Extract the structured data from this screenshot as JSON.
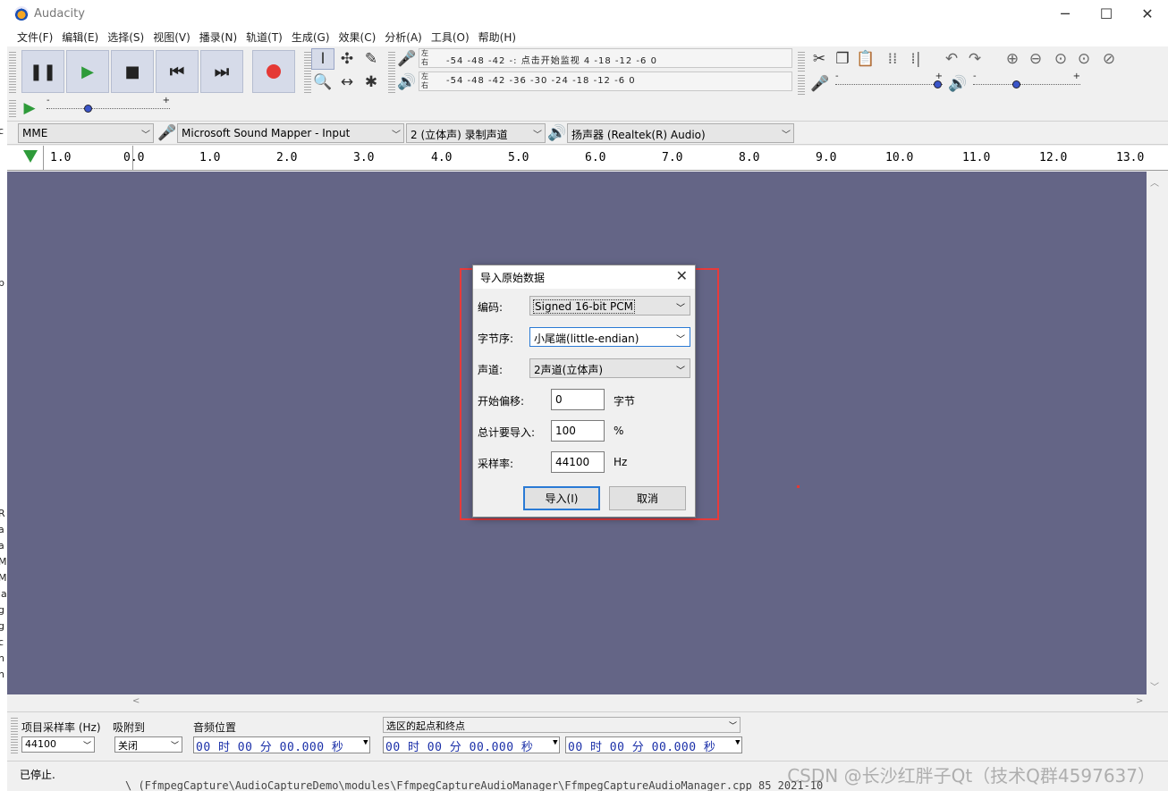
{
  "window": {
    "title": "Audacity",
    "controls": {
      "minimize": "─",
      "maximize": "☐",
      "close": "✕"
    }
  },
  "menu": [
    "文件(F)",
    "编辑(E)",
    "选择(S)",
    "视图(V)",
    "播录(N)",
    "轨道(T)",
    "生成(G)",
    "效果(C)",
    "分析(A)",
    "工具(O)",
    "帮助(H)"
  ],
  "meters": {
    "lr_label": "左\n右",
    "record_scale": "-54   -48   -42   -:  点击开始监视  4   -18   -12   -6   0",
    "play_scale": "-54   -48   -42   -36   -30   -24   -18   -12   -6   0",
    "slider_minus": "-",
    "slider_plus": "+"
  },
  "device": {
    "host": "MME",
    "input_device": "Microsoft Sound Mapper - Input",
    "channels": "2 (立体声) 录制声道",
    "output_device": "扬声器 (Realtek(R) Audio)"
  },
  "ruler": {
    "ticks": [
      "1.0",
      "0.0",
      "1.0",
      "2.0",
      "3.0",
      "4.0",
      "5.0",
      "6.0",
      "7.0",
      "8.0",
      "9.0",
      "10.0",
      "11.0",
      "12.0",
      "13.0"
    ]
  },
  "dialog": {
    "title": "导入原始数据",
    "close": "✕",
    "encoding_label": "编码:",
    "encoding_value": "Signed 16-bit PCM",
    "byteorder_label": "字节序:",
    "byteorder_value": "小尾端(little-endian)",
    "channels_label": "声道:",
    "channels_value": "2声道(立体声)",
    "offset_label": "开始偏移:",
    "offset_value": "0",
    "offset_unit": "字节",
    "amount_label": "总计要导入:",
    "amount_value": "100",
    "amount_unit": "%",
    "rate_label": "采样率:",
    "rate_value": "44100",
    "rate_unit": "Hz",
    "import_button": "导入(I)",
    "cancel_button": "取消"
  },
  "selection": {
    "rate_label": "项目采样率 (Hz)",
    "rate_value": "44100",
    "snap_label": "吸附到",
    "snap_value": "关闭",
    "position_label": "音频位置",
    "position_value": "00 时 00 分 00.000 秒",
    "range_label": "选区的起点和终点",
    "start_value": "00 时 00 分 00.000 秒",
    "end_value": "00 时 00 分 00.000 秒"
  },
  "status": {
    "text": "已停止.",
    "watermark": "CSDN @长沙红胖子Qt（技术Q群4597637）"
  },
  "background_text": "\\ (FfmpegCapture\\AudioCaptureDemo\\modules\\FfmpegCaptureAudioManager\\FfmpegCaptureAudioManager.cpp  85   2021-10",
  "left_gutter": [
    "c",
    "p",
    "R",
    "a",
    "a",
    "M",
    "M",
    "la",
    "g",
    "g",
    "c",
    "h",
    "n"
  ]
}
